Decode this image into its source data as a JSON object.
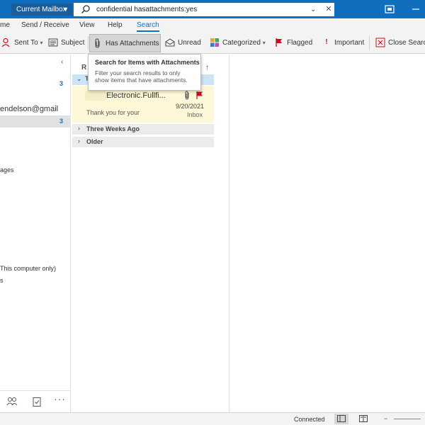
{
  "titlebar": {
    "scope_label": "Current Mailbox",
    "search_query": "confidential hasattachments:yes"
  },
  "menu": {
    "tabs": [
      {
        "label": "me"
      },
      {
        "label": "Send / Receive"
      },
      {
        "label": "View"
      },
      {
        "label": "Help"
      },
      {
        "label": "Search"
      }
    ],
    "active_tab": "Search"
  },
  "ribbon": {
    "sent_to": "Sent To",
    "subject": "Subject",
    "has_attachments": "Has Attachments",
    "unread": "Unread",
    "categorized": "Categorized",
    "flagged": "Flagged",
    "important": "Important",
    "close_search": "Close Searc"
  },
  "folder_pane": {
    "count_top": "3",
    "account": "endelson@gmail",
    "count_selected": "3",
    "item_ages": "ages",
    "item_computer": "This computer only)",
    "item_s": "s"
  },
  "message_list": {
    "header_partial": "R",
    "sort_arrow": "↑",
    "group_selected_partial": "T",
    "message": {
      "sender": "Electronic.Fullfi...",
      "date": "9/20/2021",
      "preview": "Thank you for your",
      "folder": "Inbox"
    },
    "groups": [
      {
        "label": "Three Weeks Ago"
      },
      {
        "label": "Older"
      }
    ]
  },
  "tooltip": {
    "title": "Search for Items with Attachments",
    "body": "Filter your search results to only show items that have attachments."
  },
  "statusbar": {
    "connection": "Connected"
  },
  "colors": {
    "accent": "#106ebe",
    "selected_message_bg": "#fff8d8",
    "flag": "#c50f1f"
  }
}
